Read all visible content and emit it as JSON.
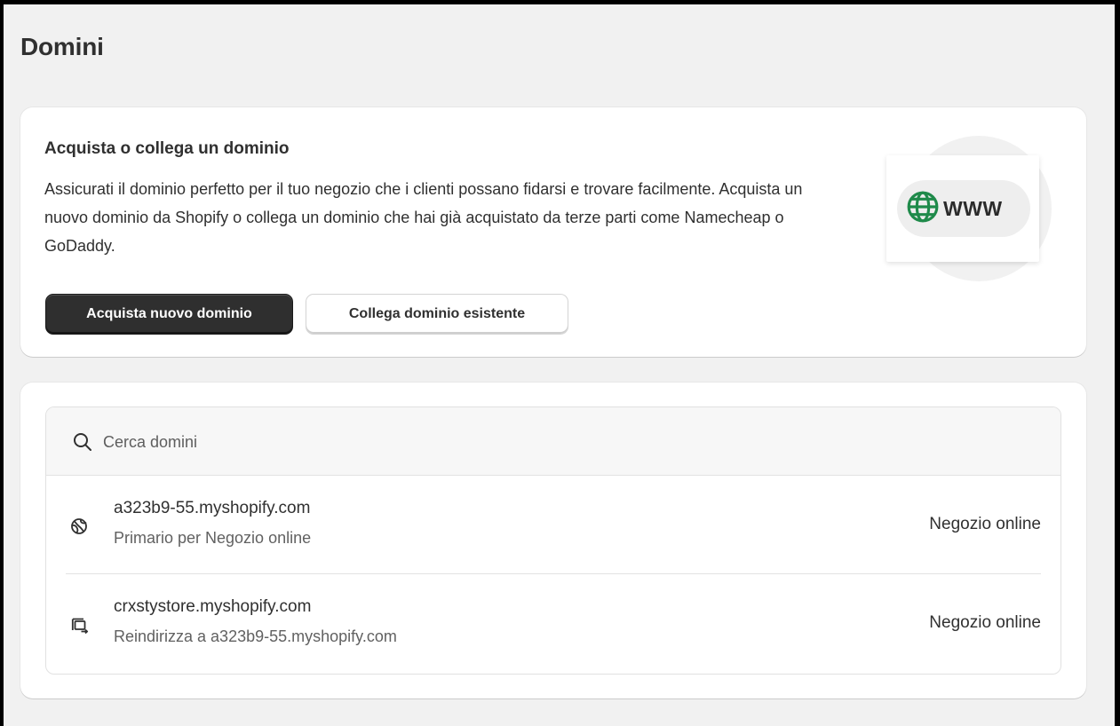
{
  "page": {
    "title": "Domini"
  },
  "promo": {
    "title": "Acquista o collega un dominio",
    "body": "Assicurati il dominio perfetto per il tuo negozio che i clienti possano fidarsi e trovare facilmente. Acquista un nuovo dominio da Shopify o collega un dominio che hai già acquistato da terze parti come Namecheap o GoDaddy.",
    "buy_button": "Acquista nuovo dominio",
    "connect_button": "Collega dominio esistente",
    "illustration_text": "WWW",
    "illustration_icon": "globe-icon"
  },
  "domains": {
    "search_placeholder": "Cerca domini",
    "items": [
      {
        "domain": "a323b9-55.myshopify.com",
        "subtitle": "Primario per Negozio online",
        "channel": "Negozio online",
        "icon": "globe-primary-icon"
      },
      {
        "domain": "crxstystore.myshopify.com",
        "subtitle": "Reindirizza a a323b9-55.myshopify.com",
        "channel": "Negozio online",
        "icon": "redirect-icon"
      }
    ]
  },
  "colors": {
    "frame_background": "#f1f1f1",
    "primary_button": "#2f2f2f",
    "globe_green": "#1f8a4a",
    "text_primary": "#303030",
    "text_secondary": "#616161"
  }
}
